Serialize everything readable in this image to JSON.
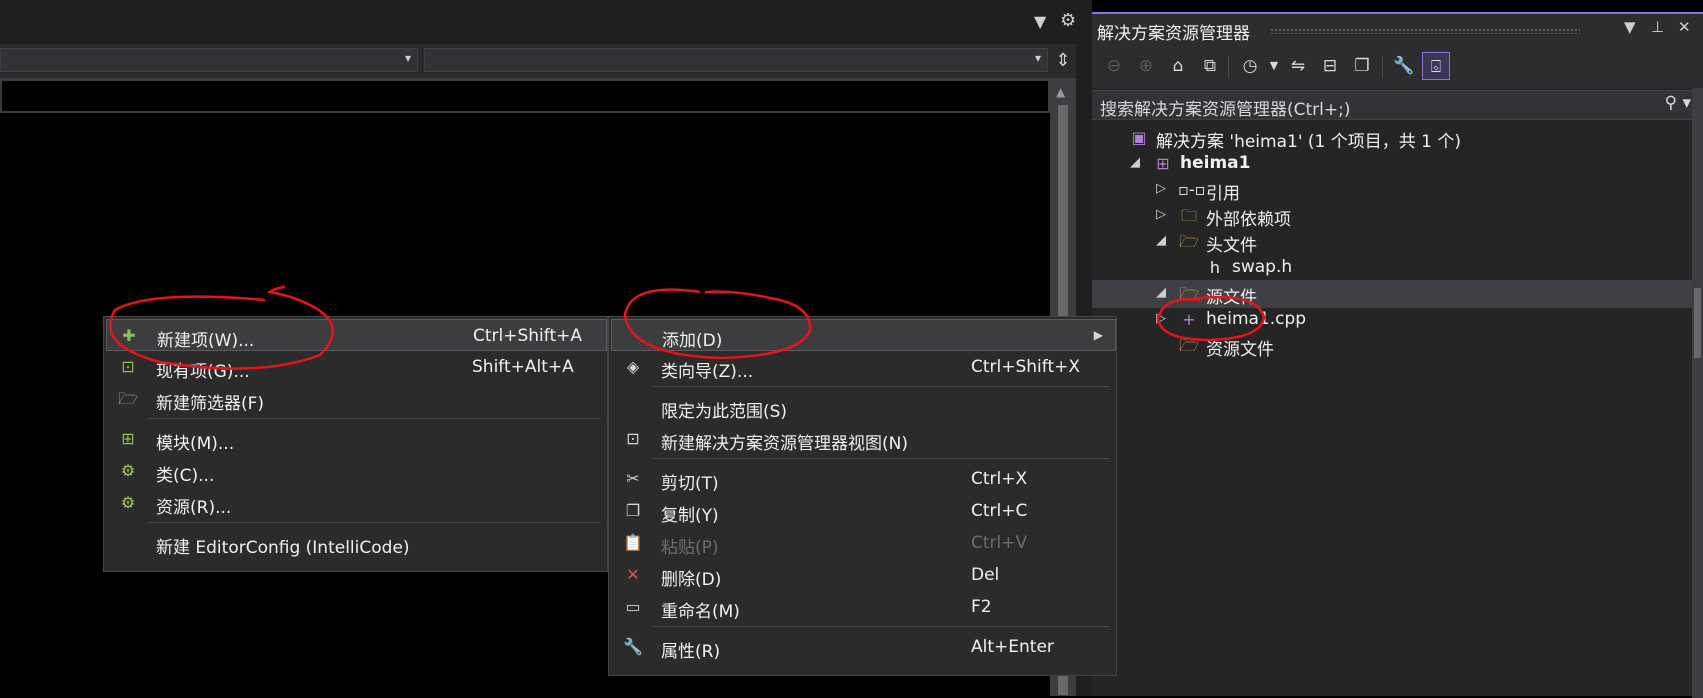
{
  "editor": {
    "scroll_up_glyph": "▲",
    "split_glyph": "⇕",
    "dropdown_glyph": "▾"
  },
  "solution_explorer": {
    "title": "解决方案资源管理器",
    "search_placeholder": "搜索解决方案资源管理器(Ctrl+;)",
    "tree": [
      {
        "label": "解决方案 'heima1' (1 个项目，共 1 个)",
        "icon": "solution-icon",
        "expander": ""
      },
      {
        "label": "heima1",
        "icon": "cpp-project-icon",
        "expander": "◢",
        "bold": true
      },
      {
        "label": "引用",
        "icon": "references-icon",
        "expander": "▷"
      },
      {
        "label": "外部依赖项",
        "icon": "external-deps-icon",
        "expander": "▷"
      },
      {
        "label": "头文件",
        "icon": "filter-folder-icon",
        "expander": "◢"
      },
      {
        "label": "swap.h",
        "icon": "header-file-icon",
        "expander": ""
      },
      {
        "label": "源文件",
        "icon": "filter-folder-icon",
        "expander": "◢",
        "selected": true
      },
      {
        "label": "heima1.cpp",
        "icon": "cpp-file-icon",
        "expander": "▷"
      },
      {
        "label": "资源文件",
        "icon": "filter-folder-icon",
        "expander": ""
      }
    ]
  },
  "add_menu": {
    "items": [
      {
        "label": "新建项(W)...",
        "shortcut": "Ctrl+Shift+A",
        "icon": "new-item-icon",
        "highlighted": true
      },
      {
        "label": "现有项(G)...",
        "shortcut": "Shift+Alt+A",
        "icon": "existing-item-icon"
      },
      {
        "label": "新建筛选器(F)",
        "shortcut": "",
        "icon": "new-filter-icon"
      },
      {
        "label": "模块(M)...",
        "shortcut": "",
        "icon": "module-icon"
      },
      {
        "label": "类(C)...",
        "shortcut": "",
        "icon": "class-icon"
      },
      {
        "label": "资源(R)...",
        "shortcut": "",
        "icon": "resource-icon"
      },
      {
        "label": "新建 EditorConfig (IntelliCode)",
        "shortcut": "",
        "icon": ""
      }
    ]
  },
  "context_menu": {
    "items": [
      {
        "label": "添加(D)",
        "shortcut": "",
        "icon": "",
        "highlighted": true,
        "submenu": true
      },
      {
        "label": "类向导(Z)...",
        "shortcut": "Ctrl+Shift+X",
        "icon": "class-wizard-icon"
      },
      {
        "label": "限定为此范围(S)",
        "shortcut": "",
        "icon": ""
      },
      {
        "label": "新建解决方案资源管理器视图(N)",
        "shortcut": "",
        "icon": "new-view-icon"
      },
      {
        "label": "剪切(T)",
        "shortcut": "Ctrl+X",
        "icon": "cut-icon"
      },
      {
        "label": "复制(Y)",
        "shortcut": "Ctrl+C",
        "icon": "copy-icon"
      },
      {
        "label": "粘贴(P)",
        "shortcut": "Ctrl+V",
        "icon": "paste-icon",
        "disabled": true
      },
      {
        "label": "删除(D)",
        "shortcut": "Del",
        "icon": "delete-icon"
      },
      {
        "label": "重命名(M)",
        "shortcut": "F2",
        "icon": "rename-icon"
      },
      {
        "label": "属性(R)",
        "shortcut": "Alt+Enter",
        "icon": "properties-icon"
      }
    ]
  },
  "colors": {
    "accent": "#8f6ee0",
    "annotation": "#e8141c",
    "folder": "#dcb67a",
    "delete": "#e05252"
  }
}
